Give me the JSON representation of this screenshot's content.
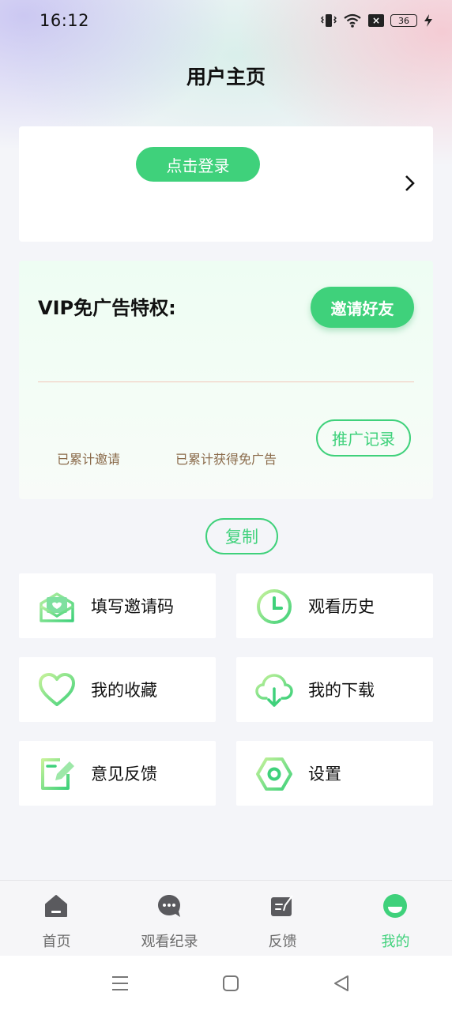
{
  "status_bar": {
    "time": "16:12",
    "battery": "36",
    "icons": [
      "vibrate-icon",
      "wifi-icon",
      "x-box-icon",
      "battery-icon",
      "charging-icon"
    ]
  },
  "header": {
    "title": "用户主页"
  },
  "login_card": {
    "login_button": "点击登录",
    "arrow_icon": "chevron-right-icon"
  },
  "vip_card": {
    "title": "VIP免广告特权:",
    "invite_button": "邀请好友",
    "stats": [
      {
        "label": "已累计邀请"
      },
      {
        "label": "已累计获得免广告"
      }
    ],
    "promo_button": "推广记录"
  },
  "copy_button": "复制",
  "menu": {
    "items": [
      {
        "label": "填写邀请码",
        "icon": "envelope-icon"
      },
      {
        "label": "观看历史",
        "icon": "clock-icon"
      },
      {
        "label": "我的收藏",
        "icon": "heart-icon"
      },
      {
        "label": "我的下载",
        "icon": "cloud-download-icon"
      },
      {
        "label": "意见反馈",
        "icon": "edit-note-icon"
      },
      {
        "label": "设置",
        "icon": "settings-hexagon-icon"
      }
    ]
  },
  "tabbar": {
    "tabs": [
      {
        "label": "首页",
        "icon": "home-icon",
        "active": false
      },
      {
        "label": "观看纪录",
        "icon": "chat-bubble-icon",
        "active": false
      },
      {
        "label": "反馈",
        "icon": "feedback-icon",
        "active": false
      },
      {
        "label": "我的",
        "icon": "profile-icon",
        "active": true
      }
    ]
  },
  "system_nav": {
    "buttons": [
      "menu-icon",
      "home-square-icon",
      "back-triangle-icon"
    ]
  },
  "colors": {
    "accent": "#3fd17b",
    "stat_text": "#8a6a4a",
    "divider": "#f2c6b8"
  }
}
